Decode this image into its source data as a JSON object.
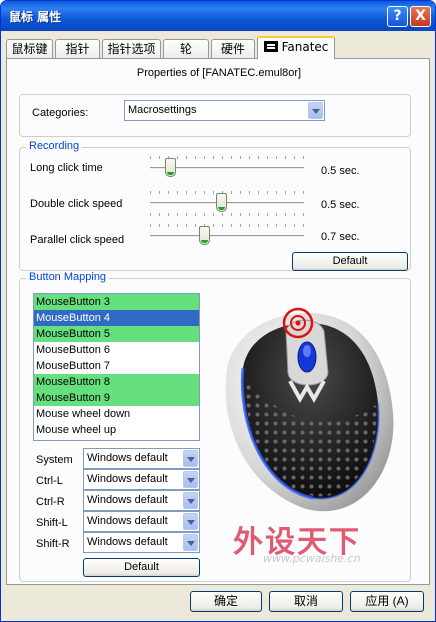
{
  "window": {
    "title": "鼠标 属性",
    "help_label": "?",
    "close_label": "X"
  },
  "tabs": [
    {
      "label": "鼠标键"
    },
    {
      "label": "指针"
    },
    {
      "label": "指针选项"
    },
    {
      "label": "轮"
    },
    {
      "label": "硬件"
    },
    {
      "label": "Fanatec",
      "active": true
    }
  ],
  "properties_title": "Properties of [FANATEC.emul8or]",
  "categories": {
    "label": "Categories:",
    "selected": "Macrosettings"
  },
  "recording": {
    "legend": "Recording",
    "sliders": [
      {
        "label": "Long click time",
        "value": "0.5 sec.",
        "level": 0.13
      },
      {
        "label": "Double click speed",
        "value": "0.5 sec.",
        "level": 0.46
      },
      {
        "label": "Parallel click speed",
        "value": "0.7 sec.",
        "level": 0.35
      }
    ],
    "default_button": "Default"
  },
  "button_mapping": {
    "legend": "Button Mapping",
    "items": [
      {
        "label": "MouseButton 3",
        "state": "green"
      },
      {
        "label": "MouseButton 4",
        "state": "selected"
      },
      {
        "label": "MouseButton 5",
        "state": "green"
      },
      {
        "label": "MouseButton 6",
        "state": "normal"
      },
      {
        "label": "MouseButton 7",
        "state": "normal"
      },
      {
        "label": "MouseButton 8",
        "state": "green"
      },
      {
        "label": "MouseButton 9",
        "state": "green"
      },
      {
        "label": "Mouse wheel down",
        "state": "normal"
      },
      {
        "label": "Mouse wheel up",
        "state": "normal"
      }
    ],
    "modifiers": [
      {
        "label": "System",
        "value": "Windows default"
      },
      {
        "label": "Ctrl-L",
        "value": "Windows default"
      },
      {
        "label": "Ctrl-R",
        "value": "Windows default"
      },
      {
        "label": "Shift-L",
        "value": "Windows default"
      },
      {
        "label": "Shift-R",
        "value": "Windows default"
      }
    ],
    "default_button": "Default"
  },
  "watermark": {
    "text": "外设天下",
    "url": "www.pcwaishe.cn"
  },
  "footer": {
    "ok": "确定",
    "cancel": "取消",
    "apply": "应用 (A)"
  },
  "colors": {
    "titlebar": "#0a5ad8",
    "legend": "#0046d5",
    "highlight_green": "#66e07f",
    "selection_blue": "#316ac5",
    "watermark": "#e25a72"
  }
}
